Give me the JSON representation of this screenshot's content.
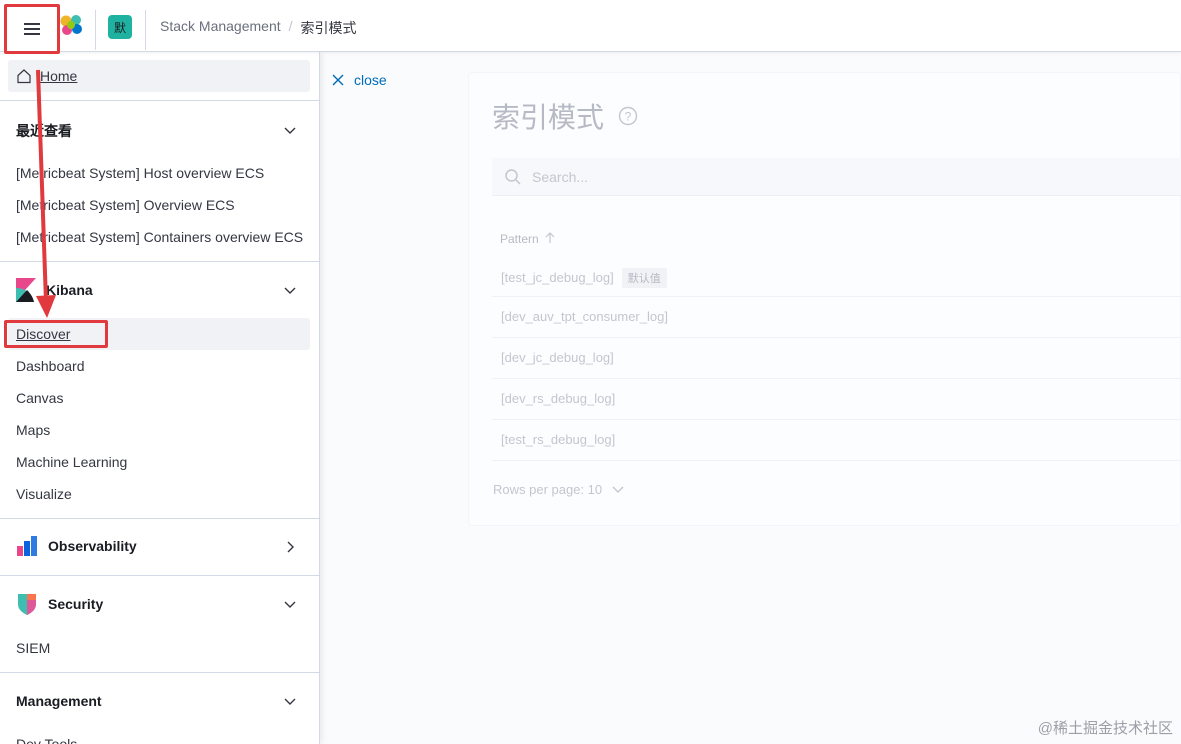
{
  "header": {
    "space_initial": "默",
    "breadcrumbs": [
      "Stack Management",
      "索引模式"
    ],
    "breadcrumb_separator": "/"
  },
  "nav": {
    "home": "Home",
    "recent": {
      "title": "最近查看",
      "items": [
        "[Metricbeat System] Host overview ECS",
        "[Metricbeat System] Overview ECS",
        "[Metricbeat System] Containers overview ECS"
      ]
    },
    "kibana": {
      "title": "Kibana",
      "items": [
        "Discover",
        "Dashboard",
        "Canvas",
        "Maps",
        "Machine Learning",
        "Visualize"
      ]
    },
    "observability": {
      "title": "Observability"
    },
    "security": {
      "title": "Security",
      "items": [
        "SIEM"
      ]
    },
    "management": {
      "title": "Management",
      "items": [
        "Dev Tools"
      ]
    }
  },
  "flyout": {
    "close_label": "close"
  },
  "index_patterns": {
    "title": "索引模式",
    "search_placeholder": "Search...",
    "column_header": "Pattern",
    "rows": [
      {
        "name": "[test_jc_debug_log]",
        "badge": "默认值"
      },
      {
        "name": "[dev_auv_tpt_consumer_log]",
        "badge": ""
      },
      {
        "name": "[dev_jc_debug_log]",
        "badge": ""
      },
      {
        "name": "[dev_rs_debug_log]",
        "badge": ""
      },
      {
        "name": "[test_rs_debug_log]",
        "badge": ""
      }
    ],
    "rows_per_page": "Rows per page: 10"
  },
  "watermark": "@稀土掘金技术社区",
  "colors": {
    "accent_link": "#006bb8",
    "annotation_red": "#e03a3e",
    "space_badge": "#20b2a0"
  }
}
